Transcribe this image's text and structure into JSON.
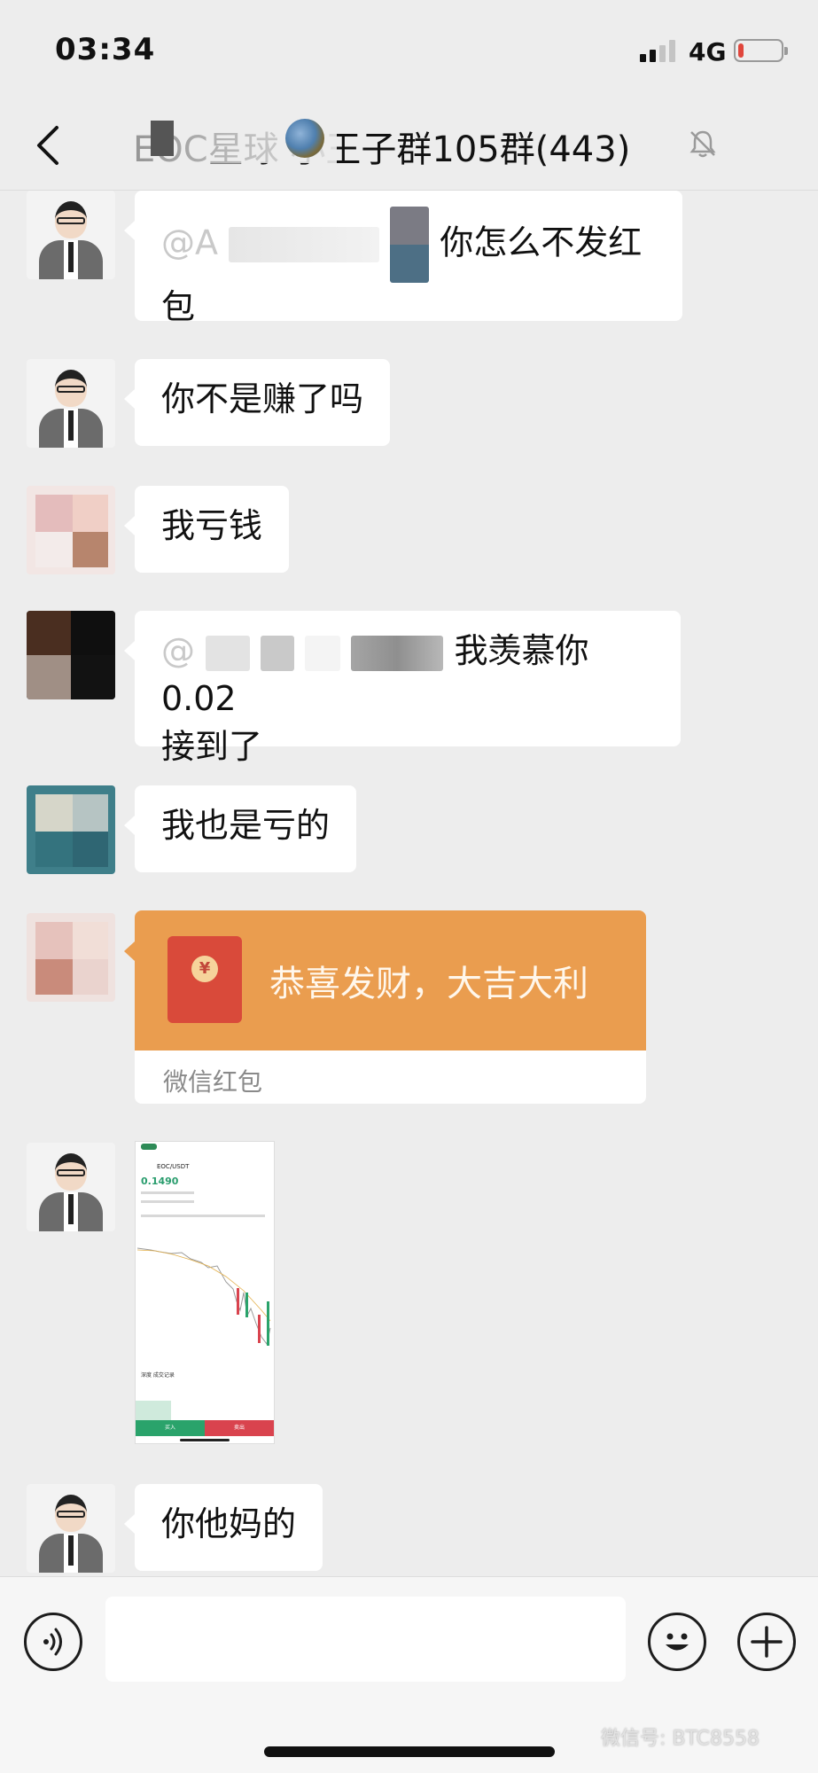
{
  "status_bar": {
    "time": "03:34",
    "network": "4G",
    "battery_level": 0.12
  },
  "nav": {
    "title": "EOC星球 小王子群105群(443)"
  },
  "messages": [
    {
      "text_before": "@A",
      "text_main": "你怎么不发红",
      "text_cont": "包"
    },
    {
      "text": "你不是赚了吗"
    },
    {
      "text": "我亏钱"
    },
    {
      "text_before": "@",
      "text_main": "我羡慕你0.02",
      "text_cont": "接到了"
    },
    {
      "text": "我也是亏的"
    },
    {
      "redpacket_title": "恭喜发财，大吉大利",
      "redpacket_label": "微信红包"
    },
    {
      "image_pair": "EOC/USDT",
      "image_price": "0.1490"
    },
    {
      "text": "你他妈的"
    }
  ],
  "input": {
    "placeholder": ""
  },
  "watermark": "微信号: BTC8558",
  "colors": {
    "background": "#ededed",
    "bubble": "#ffffff",
    "redpacket": "#ea9d4f"
  },
  "icons": [
    "back-icon",
    "mute-bell-icon",
    "voice-icon",
    "emoji-icon",
    "plus-icon"
  ]
}
